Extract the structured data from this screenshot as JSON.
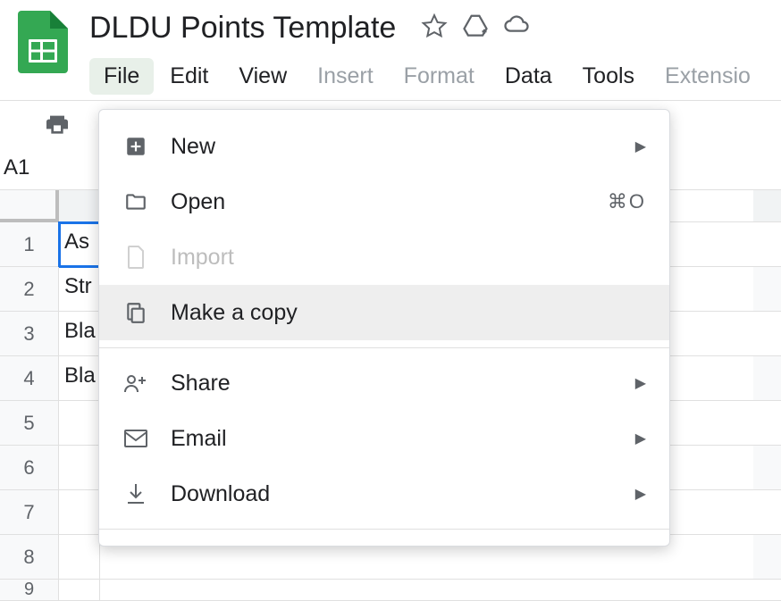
{
  "doc": {
    "title": "DLDU Points Template"
  },
  "menubar": {
    "items": [
      {
        "label": "File",
        "active": true
      },
      {
        "label": "Edit"
      },
      {
        "label": "View"
      },
      {
        "label": "Insert",
        "disabled": true
      },
      {
        "label": "Format",
        "disabled": true
      },
      {
        "label": "Data"
      },
      {
        "label": "Tools"
      },
      {
        "label": "Extensio",
        "disabled": true
      }
    ]
  },
  "cellref": "A1",
  "rows": [
    {
      "num": "1",
      "a": "As"
    },
    {
      "num": "2",
      "a": "Str"
    },
    {
      "num": "3",
      "a": "Bla"
    },
    {
      "num": "4",
      "a": "Bla"
    },
    {
      "num": "5",
      "a": ""
    },
    {
      "num": "6",
      "a": ""
    },
    {
      "num": "7",
      "a": ""
    },
    {
      "num": "8",
      "a": ""
    },
    {
      "num": "9",
      "a": ""
    }
  ],
  "dropdown": {
    "new": "New",
    "open": "Open",
    "open_shortcut": "⌘O",
    "import": "Import",
    "make_copy": "Make a copy",
    "share": "Share",
    "email": "Email",
    "download": "Download"
  }
}
